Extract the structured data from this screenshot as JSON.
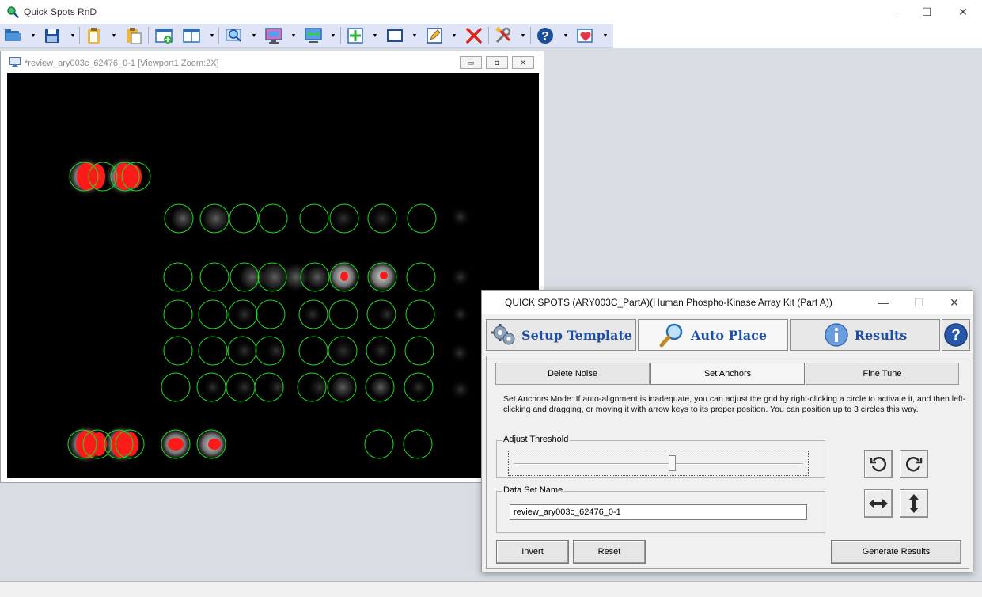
{
  "app": {
    "title": "Quick Spots RnD",
    "window_controls": {
      "minimize": "—",
      "maximize": "☐",
      "close": "✕"
    }
  },
  "toolbar": {
    "buttons": [
      {
        "icon": "open-folder-icon",
        "dropdown": true
      },
      {
        "icon": "save-icon",
        "dropdown": true
      },
      {
        "icon": "clipboard-icon",
        "dropdown": true
      },
      {
        "icon": "paste-icon",
        "dropdown": false
      },
      {
        "icon": "new-window-icon",
        "dropdown": false
      },
      {
        "icon": "split-view-icon",
        "dropdown": true
      },
      {
        "icon": "magnify-image-icon",
        "dropdown": true
      },
      {
        "icon": "display-settings-icon",
        "dropdown": true
      },
      {
        "icon": "fit-width-icon",
        "dropdown": true
      },
      {
        "icon": "add-grid-icon",
        "dropdown": true
      },
      {
        "icon": "rectangle-select-icon",
        "dropdown": true
      },
      {
        "icon": "edit-icon",
        "dropdown": true
      },
      {
        "icon": "delete-icon",
        "dropdown": false
      },
      {
        "icon": "tools-icon",
        "dropdown": true
      },
      {
        "icon": "help-icon",
        "dropdown": true
      },
      {
        "icon": "health-report-icon",
        "dropdown": true
      }
    ]
  },
  "viewport": {
    "title": "*review_ary003c_62476_0-1 [Viewport1 Zoom:2X]",
    "controls": {
      "minimize": "▭",
      "maximize": "◘",
      "close": "✕"
    },
    "spot_color": "#ff1a1a",
    "circle_color": "#1fdc1f"
  },
  "dialog": {
    "title": "QUICK SPOTS (ARY003C_PartA)(Human Phospho-Kinase Array Kit (Part A))",
    "controls": {
      "minimize": "—",
      "maximize": "☐",
      "close": "✕"
    },
    "tabs": [
      {
        "label": "Setup Template",
        "icon": "gear-icon",
        "active": false
      },
      {
        "label": "Auto Place",
        "icon": "magnifier-icon",
        "active": true
      },
      {
        "label": "Results",
        "icon": "info-icon",
        "active": false
      }
    ],
    "help_icon": "help-icon",
    "subtabs": [
      {
        "label": "Delete Noise",
        "active": false
      },
      {
        "label": "Set Anchors",
        "active": true
      },
      {
        "label": "Fine Tune",
        "active": false
      }
    ],
    "mode_text": "Set Anchors Mode: If auto-alignment is inadequate, you can adjust the grid by right-clicking a circle to activate it, and then left-clicking and dragging, or moving it with arrow keys to its proper position. You can position up to 3 circles this way.",
    "threshold": {
      "label": "Adjust Threshold",
      "value": 0.55
    },
    "dataset": {
      "label": "Data Set Name",
      "value": "review_ary003c_62476_0-1"
    },
    "buttons": {
      "invert": "Invert",
      "reset": "Reset",
      "generate": "Generate Results"
    },
    "tool_buttons": [
      "rotate-ccw-icon",
      "rotate-cw-icon",
      "stretch-horizontal-icon",
      "stretch-vertical-icon"
    ]
  }
}
